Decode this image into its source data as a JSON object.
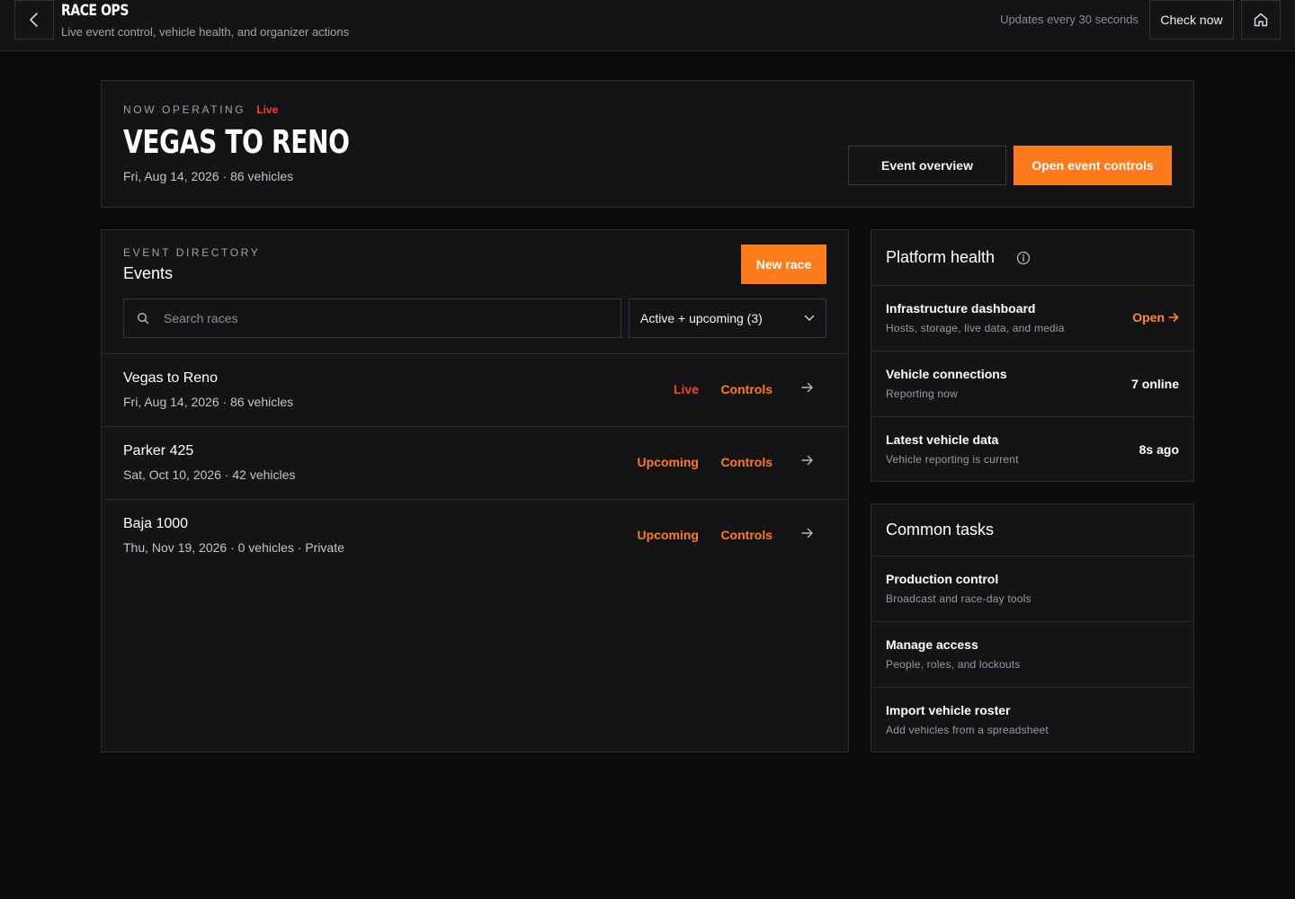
{
  "header": {
    "back_icon": "chevron-left-icon",
    "title": "RACE OPS",
    "subtitle": "Live event control, vehicle health, and organizer actions",
    "updates_text": "Updates every 30 seconds",
    "check_now_label": "Check now",
    "home_icon": "home-icon"
  },
  "now_operating": {
    "eyebrow": "NOW OPERATING",
    "status": "Live",
    "title": "VEGAS TO RENO",
    "meta": "Fri, Aug 14, 2026 · 86 vehicles",
    "overview_label": "Event overview",
    "open_controls_label": "Open event controls"
  },
  "events": {
    "eyebrow": "EVENT DIRECTORY",
    "title": "Events",
    "new_race_label": "New race",
    "search_placeholder": "Search races",
    "filter_value": "Active + upcoming (3)",
    "list": [
      {
        "name": "Vegas to Reno",
        "meta": "Fri, Aug 14, 2026 · 86 vehicles",
        "status": "Live",
        "controls": "Controls"
      },
      {
        "name": "Parker 425",
        "meta": "Sat, Oct 10, 2026 · 42 vehicles",
        "status": "Upcoming",
        "controls": "Controls"
      },
      {
        "name": "Baja 1000",
        "meta": "Thu, Nov 19, 2026 · 0 vehicles · Private",
        "status": "Upcoming",
        "controls": "Controls"
      }
    ]
  },
  "platform_health": {
    "title": "Platform health",
    "rows": [
      {
        "title": "Infrastructure dashboard",
        "subtitle": "Hosts, storage, live data, and media",
        "link": "Open"
      },
      {
        "title": "Vehicle connections",
        "subtitle": "Reporting now",
        "value": "7 online"
      },
      {
        "title": "Latest vehicle data",
        "subtitle": "Vehicle reporting is current",
        "value": "8s ago"
      }
    ]
  },
  "common_tasks": {
    "title": "Common tasks",
    "rows": [
      {
        "title": "Production control",
        "subtitle": "Broadcast and race-day tools"
      },
      {
        "title": "Manage access",
        "subtitle": "People, roles, and lockouts"
      },
      {
        "title": "Import vehicle roster",
        "subtitle": "Add vehicles from a spreadsheet"
      }
    ]
  },
  "colors": {
    "accent": "#ff7a1a",
    "live": "#ee4433",
    "background": "#0b0b0b",
    "surface": "#141416"
  }
}
